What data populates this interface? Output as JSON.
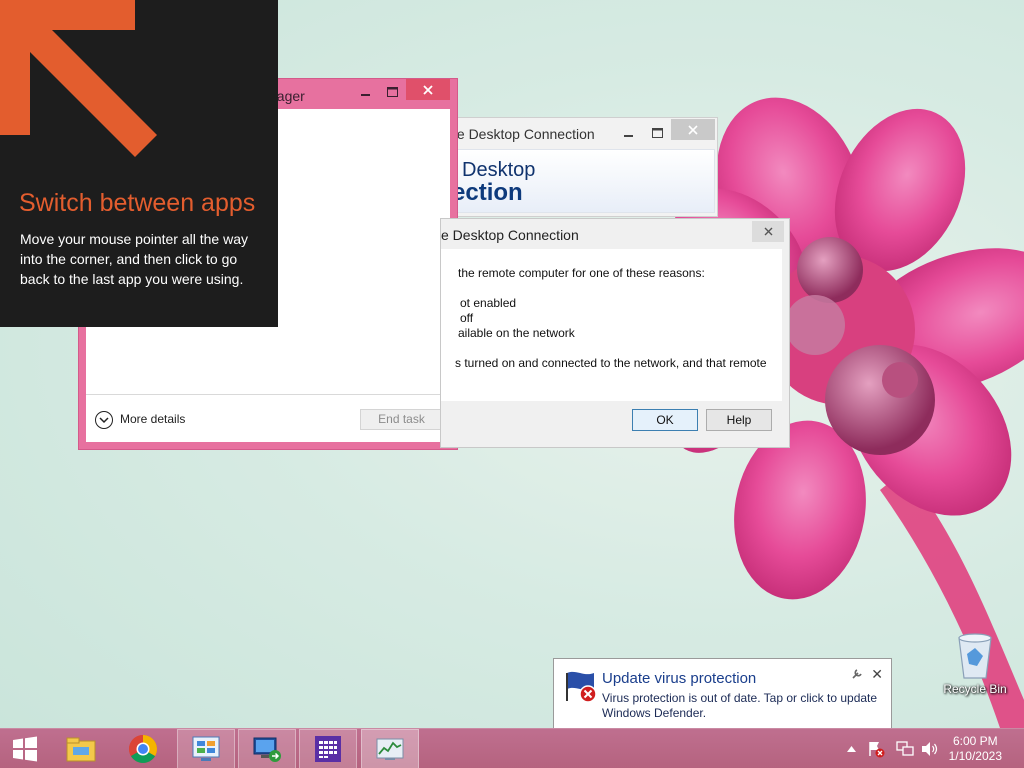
{
  "charms_tip": {
    "title": "Switch between apps",
    "body": "Move your mouse pointer all the way into the corner, and then click to go back to the last app you were using."
  },
  "task_manager": {
    "title_visible": "nager",
    "more_details_label": "More details",
    "end_task_label": "End task"
  },
  "rdc_main": {
    "title_visible": "te Desktop Connection",
    "banner_line1": "Desktop",
    "banner_line2": "ection"
  },
  "rdc_error": {
    "title_visible": "e Desktop Connection",
    "lines": [
      "the remote computer for one of these reasons:",
      "ot enabled",
      "off",
      "ailable on the network",
      "s turned on and connected to the network, and that remote"
    ],
    "ok_label": "OK",
    "help_label": "Help"
  },
  "notification": {
    "title": "Update virus protection",
    "text": "Virus protection is out of date. Tap or click to update Windows Defender.",
    "icon": "defender-warning-icon"
  },
  "desktop": {
    "recycle_bin_label": "Recycle Bin"
  },
  "taskbar": {
    "apps": [
      "start-icon",
      "file-explorer-icon",
      "chrome-icon",
      "control-panel-icon",
      "remote-desktop-icon",
      "calendar-app-icon",
      "task-manager-icon"
    ],
    "time": "6:00 PM",
    "date": "1/10/2023"
  },
  "colors": {
    "taskbar": "#b8678a",
    "task_manager_frame": "#e7719f",
    "tip_background": "#1d1d1d",
    "tip_accent": "#e35d2e",
    "toast_title": "#1a3e8c"
  }
}
